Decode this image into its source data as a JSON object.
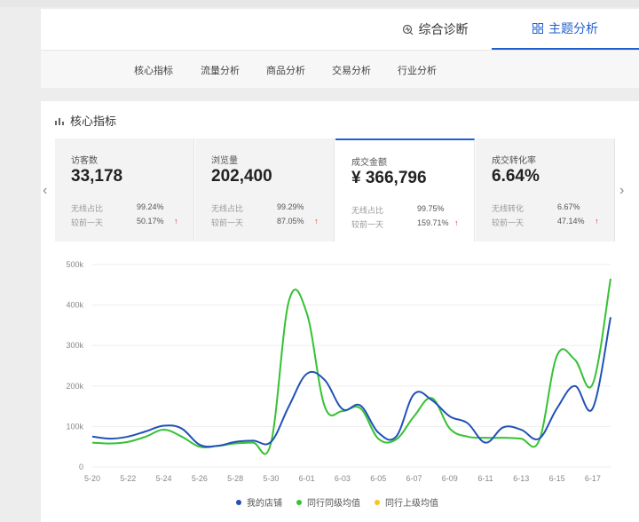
{
  "tabs": [
    {
      "label": "综合诊断",
      "active": false
    },
    {
      "label": "主题分析",
      "active": true
    }
  ],
  "subnav": [
    "核心指标",
    "流量分析",
    "商品分析",
    "交易分析",
    "行业分析"
  ],
  "panel": {
    "title": "核心指标"
  },
  "metrics": [
    {
      "label": "访客数",
      "value": "33,178",
      "r1_label": "无线占比",
      "r1_value": "99.24%",
      "r2_label": "较前一天",
      "r2_value": "50.17%",
      "active": false
    },
    {
      "label": "浏览量",
      "value": "202,400",
      "r1_label": "无线占比",
      "r1_value": "99.29%",
      "r2_label": "较前一天",
      "r2_value": "87.05%",
      "active": false
    },
    {
      "label": "成交金额",
      "value": "¥ 366,796",
      "r1_label": "无线占比",
      "r1_value": "99.75%",
      "r2_label": "较前一天",
      "r2_value": "159.71%",
      "active": true
    },
    {
      "label": "成交转化率",
      "value": "6.64%",
      "r1_label": "无线转化",
      "r1_value": "6.67%",
      "r2_label": "较前一天",
      "r2_value": "47.14%",
      "active": false
    }
  ],
  "colors": {
    "accent": "#1f5fd0",
    "up": "#d9302c"
  },
  "icons": {
    "diag": "diagnosis-icon",
    "topic": "grid-icon",
    "chart": "bar-chart-icon"
  },
  "chart_data": {
    "type": "line",
    "y_ticks": [
      "0",
      "100k",
      "200k",
      "300k",
      "400k",
      "500k"
    ],
    "ylim": [
      0,
      500000
    ],
    "x_ticks": [
      "5-20",
      "5-22",
      "5-24",
      "5-26",
      "5-28",
      "5-30",
      "6-01",
      "6-03",
      "6-05",
      "6-07",
      "6-09",
      "6-11",
      "6-13",
      "6-15",
      "6-17"
    ],
    "x": [
      "5-20",
      "5-21",
      "5-22",
      "5-23",
      "5-24",
      "5-25",
      "5-26",
      "5-27",
      "5-28",
      "5-29",
      "5-30",
      "5-31",
      "6-01",
      "6-02",
      "6-03",
      "6-04",
      "6-05",
      "6-06",
      "6-07",
      "6-08",
      "6-09",
      "6-10",
      "6-11",
      "6-12",
      "6-13",
      "6-14",
      "6-15",
      "6-16",
      "6-17",
      "6-18"
    ],
    "series": [
      {
        "name": "我的店铺",
        "color": "#2151b8",
        "values": [
          75000,
          70000,
          75000,
          88000,
          102000,
          95000,
          55000,
          52000,
          62000,
          65000,
          62000,
          150000,
          230000,
          215000,
          143000,
          152000,
          85000,
          75000,
          180000,
          165000,
          125000,
          108000,
          60000,
          98000,
          92000,
          70000,
          145000,
          200000,
          145000,
          370000
        ]
      },
      {
        "name": "同行同级均值",
        "color": "#35c234",
        "values": [
          60000,
          58000,
          62000,
          75000,
          92000,
          75000,
          50000,
          52000,
          58000,
          60000,
          60000,
          410000,
          380000,
          150000,
          138000,
          145000,
          70000,
          68000,
          125000,
          170000,
          95000,
          75000,
          72000,
          72000,
          70000,
          65000,
          275000,
          265000,
          205000,
          465000
        ]
      },
      {
        "name": "同行上级均值",
        "color": "#f5c61b",
        "values": []
      }
    ]
  }
}
